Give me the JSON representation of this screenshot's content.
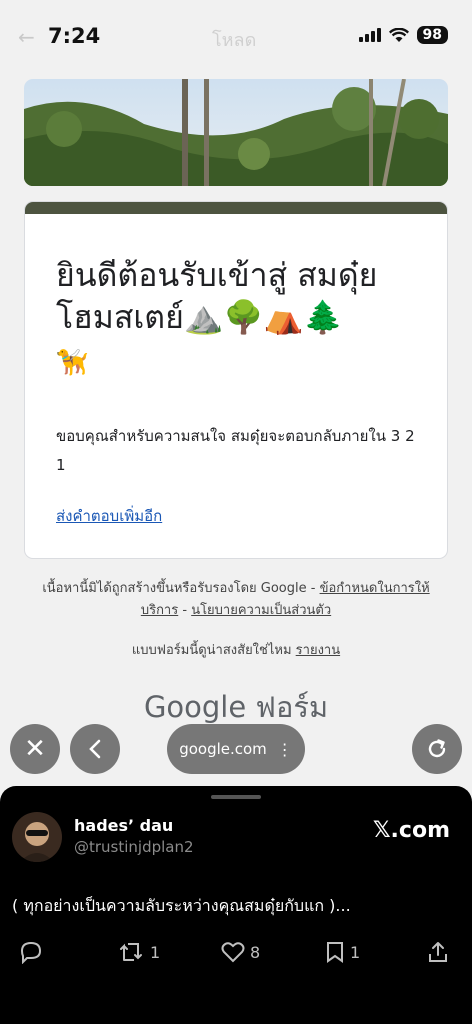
{
  "status_bar": {
    "time": "7:24",
    "battery": "98",
    "ghost_title": "โหลด"
  },
  "form": {
    "title": "ยินดีต้อนรับเข้าสู่ สมดุ๋ยโฮมสเตย์",
    "title_emoji": "⛰️🌳⛺🌲",
    "title_emoji_line2": "🦮",
    "message": "ขอบคุณสำหรับความสนใจ สมดุ๋ยจะตอบกลับภายใน 3 2 1",
    "link_label": "ส่งคำตอบเพิ่มอีก"
  },
  "footer": {
    "disclaimer_prefix": "เนื้อหานี้มิได้ถูกสร้างขึ้นหรือรับรองโดย Google - ",
    "terms_link": "ข้อกำหนดในการให้บริการ",
    "separator": " - ",
    "privacy_link": "นโยบายความเป็นส่วนตัว",
    "abuse_prefix": "แบบฟอร์มนี้ดูน่าสงสัยใช่ไหม ",
    "report_link": "รายงาน",
    "brand": "Google ฟอร์ม"
  },
  "browser": {
    "url": "google.com"
  },
  "post": {
    "display_name": "hades’ dau",
    "handle": "@trustinjdplan2",
    "brand": "𝕏.com",
    "text": "( ทุกอย่างเป็นความลับระหว่างคุณสมดุ๋ยกับแก )...",
    "retweets": "1",
    "likes": "8",
    "bookmarks": "1"
  }
}
